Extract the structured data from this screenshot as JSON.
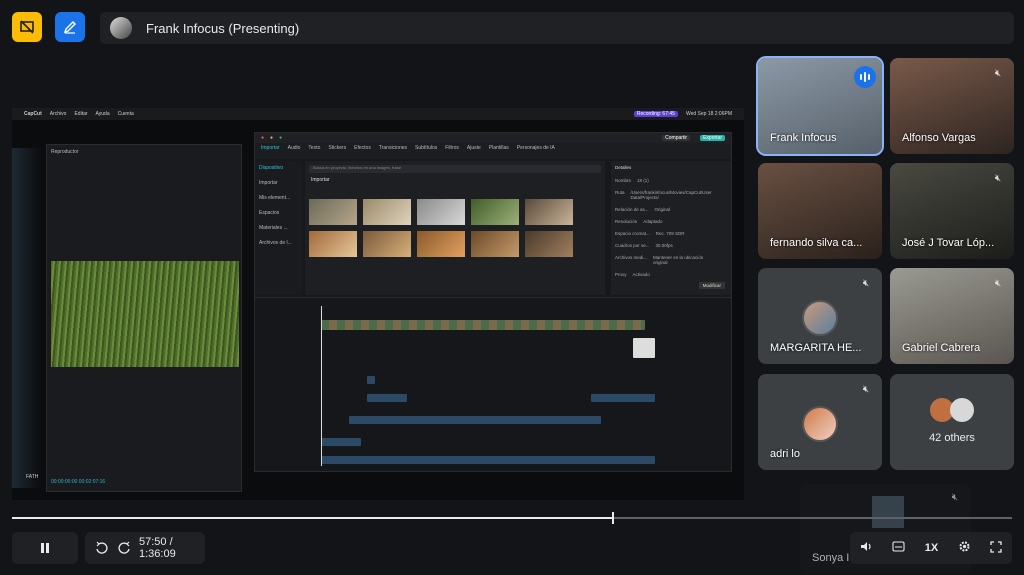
{
  "header": {
    "presenter_title": "Frank Infocus (Presenting)"
  },
  "shared_screen": {
    "menubar": {
      "app": "CapCut",
      "menus": [
        "Archivo",
        "Editar",
        "Ayuda",
        "Cuenta"
      ],
      "recording": "Recording: 67:45",
      "datetime": "Wed Sep 18 2:06PM"
    },
    "player_title": "Reproductor",
    "player_timecode": "00:00:00:00  00:02:07:16",
    "capcut_tabs": [
      "Importar",
      "Audio",
      "Texto",
      "Stickers",
      "Efectos",
      "Transiciones",
      "Subtítulos",
      "Filtros",
      "Ajuste",
      "Plantillas",
      "Personajes de IA"
    ],
    "capcut_top": {
      "share": "Compartir",
      "export": "Exportar"
    },
    "capcut_side": [
      "Dispositivo",
      "Importar",
      "Mis element...",
      "Espacios",
      "Materiales ...",
      "Archivos de l..."
    ],
    "media_search_placeholder": "Busca en proyecto, ficheros en una imagen, frase",
    "media_import": "Importar",
    "details_title": "Detalles",
    "details_rows": [
      {
        "k": "Nombre",
        "v": "18 (1)"
      },
      {
        "k": "Ruta",
        "v": "/Users/frankinfocus/Movies/CapCut/User Data/Projects/"
      },
      {
        "k": "Relación de as...",
        "v": "Original"
      },
      {
        "k": "Resolución",
        "v": "Adaptado"
      },
      {
        "k": "Espacio cromat...",
        "v": "Rec. 709 SDR"
      },
      {
        "k": "Cuadros por se...",
        "v": "30.00fps"
      },
      {
        "k": "Archivos medi...",
        "v": "Mantener en la ubicación original"
      },
      {
        "k": "Proxy",
        "v": "Activado"
      }
    ],
    "details_button": "Modificar",
    "left_label": "FATH"
  },
  "participants": [
    {
      "name": "Frank Infocus",
      "speaking": true,
      "muted": false
    },
    {
      "name": "Alfonso Vargas",
      "speaking": false,
      "muted": true
    },
    {
      "name": "fernando silva ca...",
      "speaking": false,
      "muted": false
    },
    {
      "name": "José J Tovar Lóp...",
      "speaking": false,
      "muted": true
    },
    {
      "name": "MARGARITA HE...",
      "speaking": false,
      "muted": true
    },
    {
      "name": "Gabriel Cabrera",
      "speaking": false,
      "muted": true
    },
    {
      "name": "adri lo",
      "speaking": false,
      "muted": true
    },
    {
      "name": "42 others",
      "speaking": false,
      "muted": false
    }
  ],
  "floating_tile": {
    "name": "Sonya I"
  },
  "playback": {
    "time": "57:50 / 1:36:09",
    "progress": 0.6,
    "speed": "1X",
    "skip_back": "10",
    "skip_fwd": "10"
  },
  "colors": {
    "accent_blue": "#1a73e8",
    "active_outline": "#8ab4f8",
    "tile_bg": "#3c4043",
    "brand_yellow": "#fbbc04",
    "brand_blue": "#1a73e8"
  }
}
